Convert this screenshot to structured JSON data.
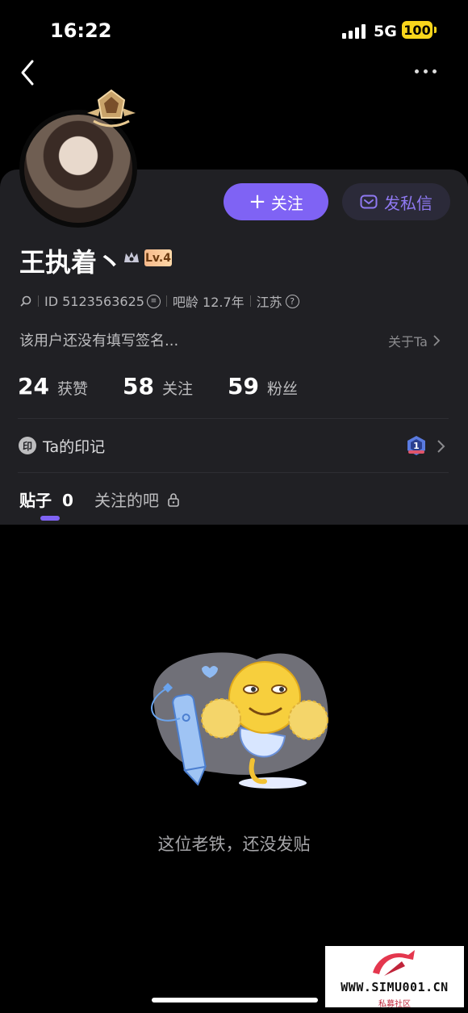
{
  "status_bar": {
    "time": "16:22",
    "network": "5G",
    "battery": "100"
  },
  "profile": {
    "name": "王执着丶",
    "level": "Lv.4",
    "id_text": "ID 5123563625",
    "bar_age": "吧龄 12.7年",
    "location": "江苏",
    "signature": "该用户还没有填写签名...",
    "about_label": "关于Ta"
  },
  "actions": {
    "follow_label": "关注",
    "message_label": "发私信"
  },
  "stats": [
    {
      "value": "24",
      "label": "获赞"
    },
    {
      "value": "58",
      "label": "关注"
    },
    {
      "value": "59",
      "label": "粉丝"
    }
  ],
  "marks": {
    "icon_char": "印",
    "label": "Ta的印记",
    "medal_number": "1"
  },
  "tabs": {
    "posts_label": "贴子",
    "posts_count": "0",
    "followed_bars_label": "关注的吧"
  },
  "empty_state": {
    "text": "这位老铁，还没发贴"
  },
  "watermark": {
    "text": "WWW.SIMU001.CN",
    "subtext": "私募社区"
  },
  "colors": {
    "accent": "#7f63f4",
    "background": "#000000",
    "panel": "#202024",
    "battery": "#f8d51c"
  }
}
